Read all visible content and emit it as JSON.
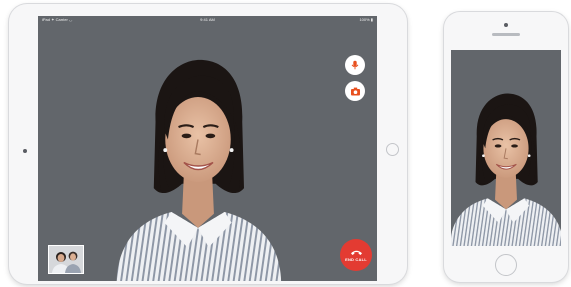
{
  "ipad": {
    "status_left": "iPad ✦  Carrier ◡",
    "status_time": "9:41 AM",
    "status_right": "100% ▮",
    "controls": {
      "mute_icon": "microphone-icon",
      "camera_icon": "camera-switch-icon",
      "end_call_icon": "phone-hangup-icon",
      "end_call_label": "END CALL"
    },
    "self_view_icon": "self-view-thumbnail"
  },
  "colors": {
    "screen_background": "#62666b",
    "end_call": "#e33b32",
    "control_icon": "#e8501f"
  }
}
